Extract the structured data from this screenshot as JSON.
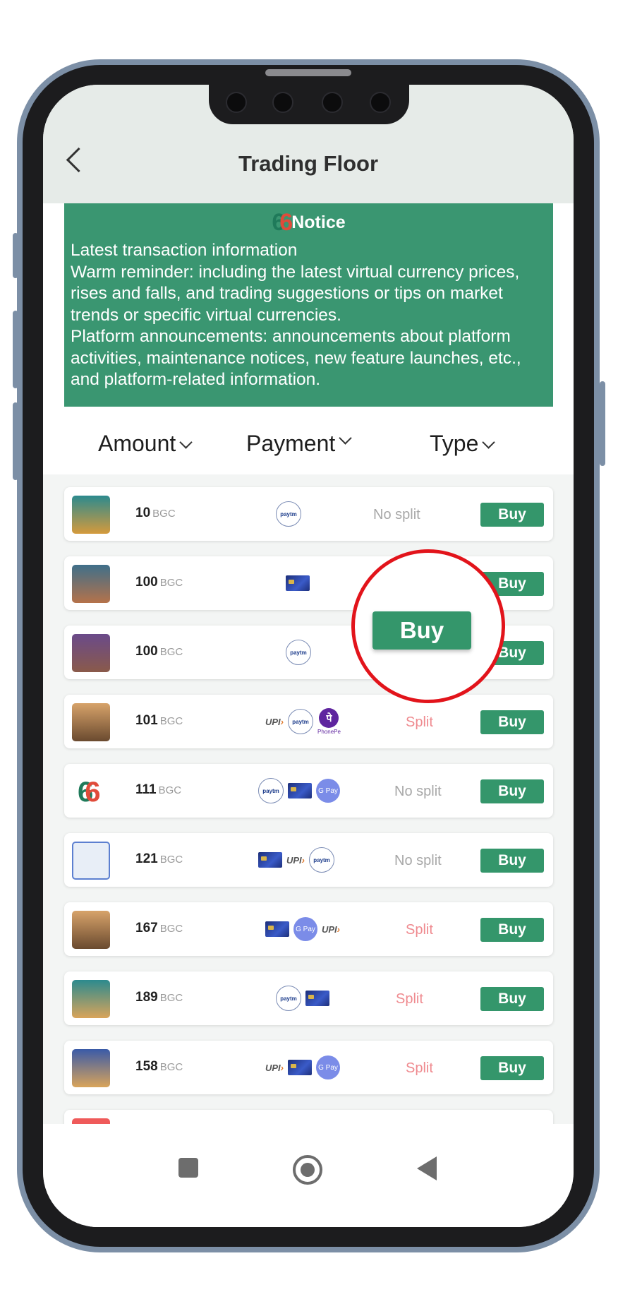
{
  "header": {
    "title": "Trading Floor"
  },
  "notice": {
    "heading": "Notice",
    "line1": "Latest transaction information",
    "line2": "Warm reminder: including the latest virtual currency prices, rises and falls, and trading suggestions or tips on market trends or specific virtual currencies.",
    "line3": "Platform announcements: announcements about platform activities, maintenance notices, new feature launches, etc., and platform-related information."
  },
  "filters": {
    "amount": "Amount",
    "payment": "Payment",
    "type": "Type"
  },
  "currency_unit": "BGC",
  "buy_label": "Buy",
  "callout_label": "Buy",
  "rows": [
    {
      "amount": "10",
      "payments": [
        "paytm"
      ],
      "split": "No split"
    },
    {
      "amount": "100",
      "payments": [
        "card"
      ],
      "split": ""
    },
    {
      "amount": "100",
      "payments": [
        "paytm"
      ],
      "split": ""
    },
    {
      "amount": "101",
      "payments": [
        "upi",
        "paytm",
        "phonepe"
      ],
      "split": "Split"
    },
    {
      "amount": "111",
      "payments": [
        "paytm",
        "card",
        "gpay"
      ],
      "split": "No split"
    },
    {
      "amount": "121",
      "payments": [
        "card",
        "upi",
        "paytm"
      ],
      "split": "No split"
    },
    {
      "amount": "167",
      "payments": [
        "card",
        "gpay",
        "upi"
      ],
      "split": "Split"
    },
    {
      "amount": "189",
      "payments": [
        "paytm",
        "card"
      ],
      "split": "Split"
    },
    {
      "amount": "158",
      "payments": [
        "upi",
        "card",
        "gpay"
      ],
      "split": "Split"
    }
  ],
  "payment_icon_text": {
    "paytm": "paytm",
    "upi": "UPI",
    "gpay": "G Pay",
    "phonepe_glyph": "पे",
    "phonepe_name": "PhonePe"
  },
  "colors": {
    "accent": "#34966b",
    "notice_bg": "#3a9671",
    "split": "#ef8a8f",
    "no_split": "#a7a7a7",
    "callout": "#e2141b"
  }
}
